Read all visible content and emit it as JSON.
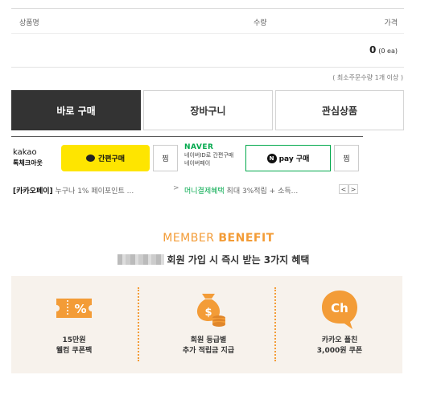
{
  "table": {
    "col_product": "상품명",
    "col_qty": "수량",
    "col_price": "가격"
  },
  "total": {
    "value": "0",
    "unit": "(0 ea)"
  },
  "min_order": "( 최소주문수량 1개 이상 )",
  "buttons": {
    "buy_now": "바로 구매",
    "cart": "장바구니",
    "wishlist": "관심상품"
  },
  "kakao": {
    "logo": "kakao",
    "checkout": "톡체크아웃",
    "pay_label": "간편구매",
    "zzim": "찜"
  },
  "naver": {
    "logo": "NAVER",
    "line1": "네이버ID로 간편구매",
    "line2": "네이버페이",
    "pay_label": "pay 구매",
    "badge": "N",
    "zzim": "찜"
  },
  "promo": {
    "kakao_tag": "[카카오페이]",
    "kakao_text": " 누구나 1% 페이포인트 ...",
    "arrow": ">",
    "naver_tag": "머니결제혜택",
    "naver_text": " 최대 3%적립 + 소득...",
    "prev": "<",
    "next": ">"
  },
  "member": {
    "title_light": "MEMBER ",
    "title_bold": "BENEFIT",
    "subtitle": "회원 가입 시 즉시 받는 3가지 혜택"
  },
  "benefits": [
    {
      "icon": "coupon-percent-icon",
      "line1": "15만원",
      "line2": "웰컴 쿠폰팩"
    },
    {
      "icon": "money-bag-coins-icon",
      "line1": "회원 등급별",
      "line2": "추가 적립금 지급"
    },
    {
      "icon": "kakao-channel-icon",
      "line1": "카카오 플친",
      "line2": "3,000원 쿠폰"
    }
  ],
  "colors": {
    "accent": "#f39c37",
    "kakao_yellow": "#fee500",
    "naver_green": "#03a94d",
    "dark_button": "#333333"
  }
}
